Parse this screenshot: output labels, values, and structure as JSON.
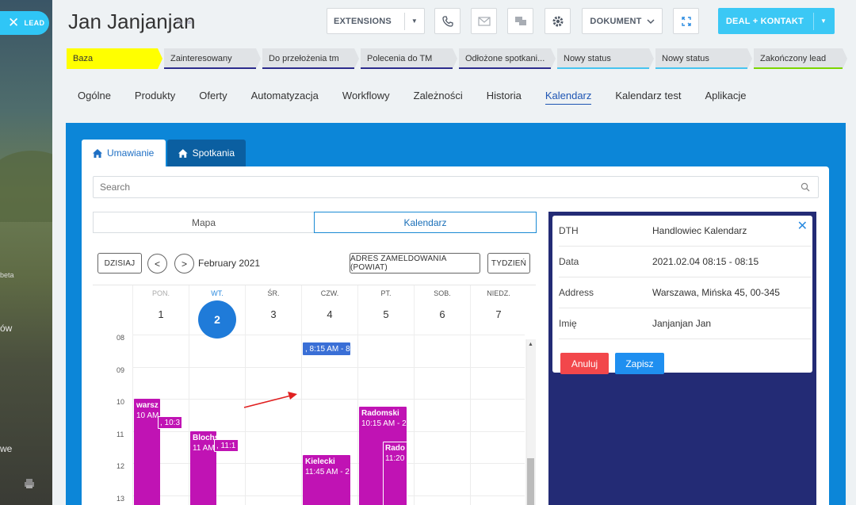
{
  "sidebar": {
    "lead_label": "LEAD",
    "texts": [
      "beta",
      "ów",
      "we"
    ]
  },
  "header": {
    "title": "Jan Janjanjan",
    "extensions_label": "EXTENSIONS",
    "dokument_label": "DOKUMENT",
    "deal_label": "DEAL + KONTAKT"
  },
  "stages": [
    {
      "label": "Baza",
      "bg": "#ffff00",
      "bar": "#ffff00"
    },
    {
      "label": "Zainteresowany",
      "bg": "#e0e3e6",
      "bar": "#2c2c8c"
    },
    {
      "label": "Do przełożenia tm",
      "bg": "#e0e3e6",
      "bar": "#2c2c8c"
    },
    {
      "label": "Polecenia do TM",
      "bg": "#e0e3e6",
      "bar": "#2c2c8c"
    },
    {
      "label": "Odłożone spotkani...",
      "bg": "#e0e3e6",
      "bar": "#2c2c8c"
    },
    {
      "label": "Nowy status",
      "bg": "#e0e3e6",
      "bar": "#47c4ef"
    },
    {
      "label": "Nowy status",
      "bg": "#e0e3e6",
      "bar": "#47c4ef"
    },
    {
      "label": "Zakończony lead",
      "bg": "#e0e3e6",
      "bar": "#7bd500"
    }
  ],
  "tabs": [
    "Ogólne",
    "Produkty",
    "Oferty",
    "Automatyzacja",
    "Workflowy",
    "Zależności",
    "Historia",
    "Kalendarz",
    "Kalendarz test",
    "Aplikacje"
  ],
  "active_tab": "Kalendarz",
  "panel": {
    "tab_umawianie": "Umawianie",
    "tab_spotkania": "Spotkania",
    "search_placeholder": "Search",
    "seg_mapa": "Mapa",
    "seg_kalendarz": "Kalendarz"
  },
  "calendar": {
    "today_btn": "DZISIAJ",
    "prev": "<",
    "next": ">",
    "month": "February 2021",
    "address_btn": "ADRES ZAMELDOWANIA (POWIAT)",
    "week_btn": "TYDZIEŃ",
    "days": [
      {
        "name": "PON.",
        "num": "1",
        "state": "past"
      },
      {
        "name": "WT.",
        "num": "2",
        "state": "today"
      },
      {
        "name": "ŚR.",
        "num": "3",
        "state": ""
      },
      {
        "name": "CZW.",
        "num": "4",
        "state": ""
      },
      {
        "name": "PT.",
        "num": "5",
        "state": ""
      },
      {
        "name": "SOB.",
        "num": "6",
        "state": ""
      },
      {
        "name": "NIEDZ.",
        "num": "7",
        "state": ""
      }
    ],
    "hours": [
      "08",
      "09",
      "10",
      "11",
      "12",
      "13"
    ],
    "events": [
      {
        "title": "warsz",
        "time": "10 AM",
        "day": 0,
        "start": 10.0,
        "end": 13.5,
        "col": 0,
        "style": "main"
      },
      {
        "title": "",
        "time": ", 10:3",
        "day": 0,
        "start": 10.55,
        "end": 10.95,
        "col": 1,
        "style": "small"
      },
      {
        "title": "Blochski",
        "time": "11 AM",
        "day": 1,
        "start": 11.0,
        "end": 13.5,
        "col": 0,
        "style": "main"
      },
      {
        "title": "",
        "time": ", 11:1",
        "day": 1,
        "start": 11.25,
        "end": 11.65,
        "col": 1,
        "style": "small"
      },
      {
        "title": "Kielecki",
        "time": "11:45 AM - 2",
        "day": 3,
        "start": 11.75,
        "end": 13.5,
        "col": 0,
        "style": "main"
      },
      {
        "title": "Radomski",
        "time": "10:15 AM - 2",
        "day": 4,
        "start": 10.25,
        "end": 13.5,
        "col": 0,
        "style": "main"
      },
      {
        "title": "Rado",
        "time": "11:20",
        "day": 4,
        "start": 11.33,
        "end": 13.5,
        "col": 1,
        "style": "small"
      },
      {
        "title": "",
        "time": ", 8:15 AM - 8",
        "day": 3,
        "start": 8.25,
        "end": 8.65,
        "col": 0,
        "style": "blue"
      }
    ]
  },
  "details": {
    "rows": [
      {
        "key": "DTH",
        "value": "Handlowiec Kalendarz"
      },
      {
        "key": "Data",
        "value": "2021.02.04 08:15 - 08:15"
      },
      {
        "key": "Address",
        "value": "Warszawa, Mińska 45, 00-345"
      },
      {
        "key": "Imię",
        "value": "Janjanjan Jan"
      }
    ],
    "cancel": "Anuluj",
    "save": "Zapisz"
  },
  "colors": {
    "accent": "#1e55b3",
    "panel_blue": "#0c86d8",
    "event_magenta": "#c013b4",
    "detail_navy": "#232b75"
  }
}
